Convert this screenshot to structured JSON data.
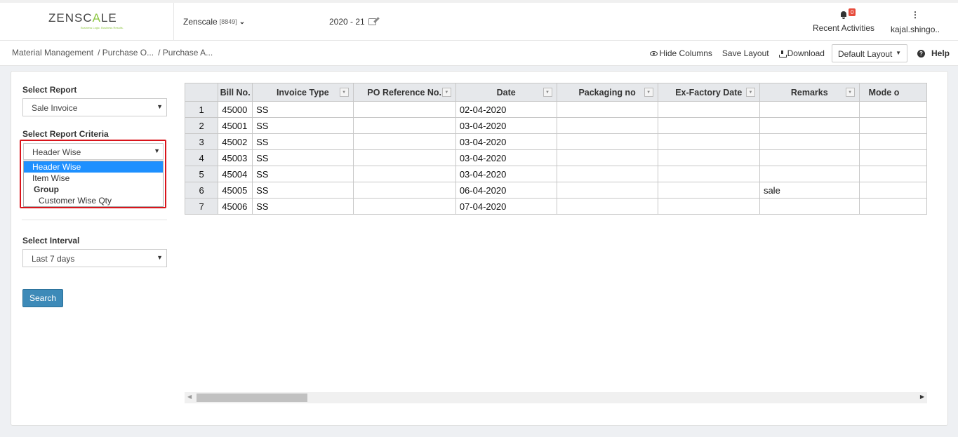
{
  "header": {
    "logo_text_a": "ZENSC",
    "logo_text_b": "A",
    "logo_text_c": "LE",
    "logo_tagline": "Business Logic. Business Results.",
    "company_name": "Zenscale",
    "company_code": "[8849]",
    "financial_year": "2020 - 21",
    "notifications_count": "0",
    "recent_activities_label": "Recent Activities",
    "user_name": "kajal.shingo.."
  },
  "breadcrumb": [
    "Material Management",
    "/ Purchase O...",
    "/ Purchase A..."
  ],
  "toolbar": {
    "hide_columns": "Hide Columns",
    "save_layout": "Save Layout",
    "download": "Download",
    "layout_value": "Default Layout",
    "help": "Help"
  },
  "filters": {
    "report_label": "Select Report",
    "report_value": "Sale Invoice",
    "criteria_label": "Select Report Criteria",
    "criteria_value": "Header Wise",
    "criteria_options": [
      {
        "label": "Header Wise",
        "selected": true
      },
      {
        "label": "Item Wise"
      },
      {
        "label": "Group",
        "group": true
      },
      {
        "label": "Customer Wise Qty",
        "sub": true
      }
    ],
    "interval_label": "Select Interval",
    "interval_value": "Last 7 days",
    "search_button": "Search"
  },
  "grid": {
    "columns": [
      "Bill No.",
      "Invoice Type",
      "PO Reference No.",
      "Date",
      "Packaging no",
      "Ex-Factory Date",
      "Remarks",
      "Mode o"
    ],
    "rows": [
      {
        "n": "1",
        "bill": "45000",
        "type": "SS",
        "po": "",
        "date": "02-04-2020",
        "pack": "",
        "exf": "",
        "remarks": ""
      },
      {
        "n": "2",
        "bill": "45001",
        "type": "SS",
        "po": "",
        "date": "03-04-2020",
        "pack": "",
        "exf": "",
        "remarks": ""
      },
      {
        "n": "3",
        "bill": "45002",
        "type": "SS",
        "po": "",
        "date": "03-04-2020",
        "pack": "",
        "exf": "",
        "remarks": ""
      },
      {
        "n": "4",
        "bill": "45003",
        "type": "SS",
        "po": "",
        "date": "03-04-2020",
        "pack": "",
        "exf": "",
        "remarks": ""
      },
      {
        "n": "5",
        "bill": "45004",
        "type": "SS",
        "po": "",
        "date": "03-04-2020",
        "pack": "",
        "exf": "",
        "remarks": ""
      },
      {
        "n": "6",
        "bill": "45005",
        "type": "SS",
        "po": "",
        "date": "06-04-2020",
        "pack": "",
        "exf": "",
        "remarks": "sale"
      },
      {
        "n": "7",
        "bill": "45006",
        "type": "SS",
        "po": "",
        "date": "07-04-2020",
        "pack": "",
        "exf": "",
        "remarks": ""
      }
    ]
  }
}
